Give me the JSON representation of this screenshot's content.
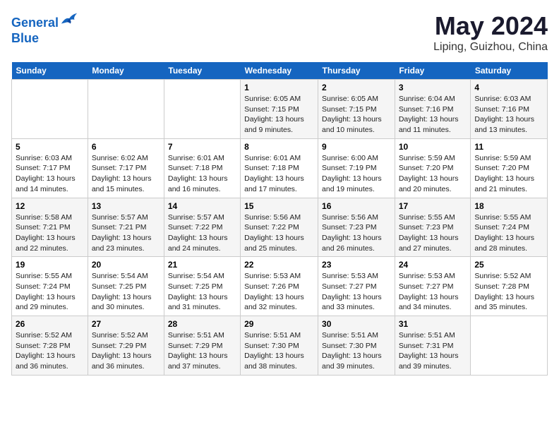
{
  "logo": {
    "line1": "General",
    "line2": "Blue"
  },
  "title": "May 2024",
  "subtitle": "Liping, Guizhou, China",
  "days_header": [
    "Sunday",
    "Monday",
    "Tuesday",
    "Wednesday",
    "Thursday",
    "Friday",
    "Saturday"
  ],
  "weeks": [
    [
      {
        "day": "",
        "info": ""
      },
      {
        "day": "",
        "info": ""
      },
      {
        "day": "",
        "info": ""
      },
      {
        "day": "1",
        "info": "Sunrise: 6:05 AM\nSunset: 7:15 PM\nDaylight: 13 hours\nand 9 minutes."
      },
      {
        "day": "2",
        "info": "Sunrise: 6:05 AM\nSunset: 7:15 PM\nDaylight: 13 hours\nand 10 minutes."
      },
      {
        "day": "3",
        "info": "Sunrise: 6:04 AM\nSunset: 7:16 PM\nDaylight: 13 hours\nand 11 minutes."
      },
      {
        "day": "4",
        "info": "Sunrise: 6:03 AM\nSunset: 7:16 PM\nDaylight: 13 hours\nand 13 minutes."
      }
    ],
    [
      {
        "day": "5",
        "info": "Sunrise: 6:03 AM\nSunset: 7:17 PM\nDaylight: 13 hours\nand 14 minutes."
      },
      {
        "day": "6",
        "info": "Sunrise: 6:02 AM\nSunset: 7:17 PM\nDaylight: 13 hours\nand 15 minutes."
      },
      {
        "day": "7",
        "info": "Sunrise: 6:01 AM\nSunset: 7:18 PM\nDaylight: 13 hours\nand 16 minutes."
      },
      {
        "day": "8",
        "info": "Sunrise: 6:01 AM\nSunset: 7:18 PM\nDaylight: 13 hours\nand 17 minutes."
      },
      {
        "day": "9",
        "info": "Sunrise: 6:00 AM\nSunset: 7:19 PM\nDaylight: 13 hours\nand 19 minutes."
      },
      {
        "day": "10",
        "info": "Sunrise: 5:59 AM\nSunset: 7:20 PM\nDaylight: 13 hours\nand 20 minutes."
      },
      {
        "day": "11",
        "info": "Sunrise: 5:59 AM\nSunset: 7:20 PM\nDaylight: 13 hours\nand 21 minutes."
      }
    ],
    [
      {
        "day": "12",
        "info": "Sunrise: 5:58 AM\nSunset: 7:21 PM\nDaylight: 13 hours\nand 22 minutes."
      },
      {
        "day": "13",
        "info": "Sunrise: 5:57 AM\nSunset: 7:21 PM\nDaylight: 13 hours\nand 23 minutes."
      },
      {
        "day": "14",
        "info": "Sunrise: 5:57 AM\nSunset: 7:22 PM\nDaylight: 13 hours\nand 24 minutes."
      },
      {
        "day": "15",
        "info": "Sunrise: 5:56 AM\nSunset: 7:22 PM\nDaylight: 13 hours\nand 25 minutes."
      },
      {
        "day": "16",
        "info": "Sunrise: 5:56 AM\nSunset: 7:23 PM\nDaylight: 13 hours\nand 26 minutes."
      },
      {
        "day": "17",
        "info": "Sunrise: 5:55 AM\nSunset: 7:23 PM\nDaylight: 13 hours\nand 27 minutes."
      },
      {
        "day": "18",
        "info": "Sunrise: 5:55 AM\nSunset: 7:24 PM\nDaylight: 13 hours\nand 28 minutes."
      }
    ],
    [
      {
        "day": "19",
        "info": "Sunrise: 5:55 AM\nSunset: 7:24 PM\nDaylight: 13 hours\nand 29 minutes."
      },
      {
        "day": "20",
        "info": "Sunrise: 5:54 AM\nSunset: 7:25 PM\nDaylight: 13 hours\nand 30 minutes."
      },
      {
        "day": "21",
        "info": "Sunrise: 5:54 AM\nSunset: 7:25 PM\nDaylight: 13 hours\nand 31 minutes."
      },
      {
        "day": "22",
        "info": "Sunrise: 5:53 AM\nSunset: 7:26 PM\nDaylight: 13 hours\nand 32 minutes."
      },
      {
        "day": "23",
        "info": "Sunrise: 5:53 AM\nSunset: 7:27 PM\nDaylight: 13 hours\nand 33 minutes."
      },
      {
        "day": "24",
        "info": "Sunrise: 5:53 AM\nSunset: 7:27 PM\nDaylight: 13 hours\nand 34 minutes."
      },
      {
        "day": "25",
        "info": "Sunrise: 5:52 AM\nSunset: 7:28 PM\nDaylight: 13 hours\nand 35 minutes."
      }
    ],
    [
      {
        "day": "26",
        "info": "Sunrise: 5:52 AM\nSunset: 7:28 PM\nDaylight: 13 hours\nand 36 minutes."
      },
      {
        "day": "27",
        "info": "Sunrise: 5:52 AM\nSunset: 7:29 PM\nDaylight: 13 hours\nand 36 minutes."
      },
      {
        "day": "28",
        "info": "Sunrise: 5:51 AM\nSunset: 7:29 PM\nDaylight: 13 hours\nand 37 minutes."
      },
      {
        "day": "29",
        "info": "Sunrise: 5:51 AM\nSunset: 7:30 PM\nDaylight: 13 hours\nand 38 minutes."
      },
      {
        "day": "30",
        "info": "Sunrise: 5:51 AM\nSunset: 7:30 PM\nDaylight: 13 hours\nand 39 minutes."
      },
      {
        "day": "31",
        "info": "Sunrise: 5:51 AM\nSunset: 7:31 PM\nDaylight: 13 hours\nand 39 minutes."
      },
      {
        "day": "",
        "info": ""
      }
    ]
  ]
}
